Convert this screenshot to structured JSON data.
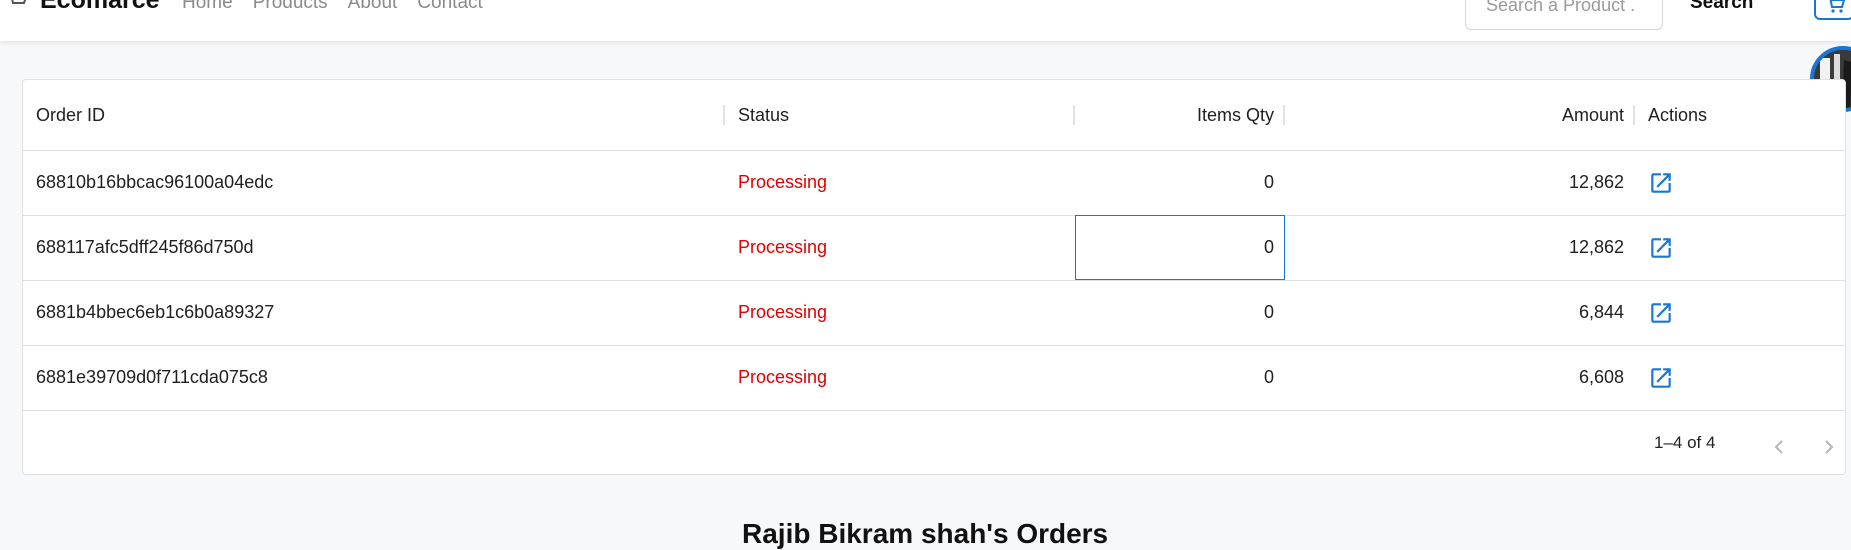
{
  "navbar": {
    "brand": "Ecomarce",
    "links": [
      "Home",
      "Products",
      "About",
      "Contact"
    ],
    "search_placeholder": "Search a Product .",
    "search_button": "Search"
  },
  "grid": {
    "columns": [
      "Order ID",
      "Status",
      "Items Qty",
      "Amount",
      "Actions"
    ],
    "rows": [
      {
        "id": "68810b16bbcac96100a04edc",
        "status": "Processing",
        "qty": "0",
        "amount": "12,862"
      },
      {
        "id": "688117afc5dff245f86d750d",
        "status": "Processing",
        "qty": "0",
        "amount": "12,862"
      },
      {
        "id": "6881b4bbec6eb1c6b0a89327",
        "status": "Processing",
        "qty": "0",
        "amount": "6,844"
      },
      {
        "id": "6881e39709d0f711cda075c8",
        "status": "Processing",
        "qty": "0",
        "amount": "6,608"
      }
    ],
    "pagination": "1–4 of 4"
  },
  "page": {
    "heading": "Rajib Bikram shah's Orders"
  },
  "icons": {
    "cart": "cart-icon",
    "action": "open-in-new-icon",
    "prev": "chevron-left-icon",
    "next": "chevron-right-icon"
  },
  "colors": {
    "accent": "#1976d2",
    "status_processing": "#e00000"
  }
}
